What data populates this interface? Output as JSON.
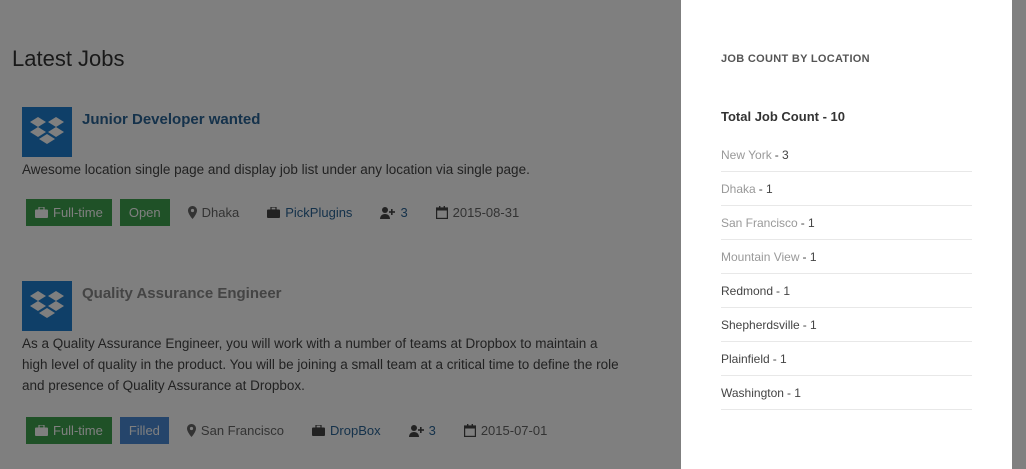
{
  "main": {
    "title": "Latest Jobs",
    "jobs": [
      {
        "title": "Junior Developer wanted",
        "description": "Awesome location single page and display job list under any location via single page.",
        "type": "Full-time",
        "status": "Open",
        "location": "Dhaka",
        "company": "PickPlugins",
        "applicants": "3",
        "date": "2015-08-31"
      },
      {
        "title": "Quality Assurance Engineer",
        "description": "As a Quality Assurance Engineer, you will work with a number of teams at Dropbox to maintain a high level of quality in the product. You will be joining a small team at a critical time to define the role and presence of Quality Assurance at Dropbox.",
        "type": "Full-time",
        "status": "Filled",
        "location": "San Francisco",
        "company": "DropBox",
        "applicants": "3",
        "date": "2015-07-01"
      }
    ]
  },
  "sidebar": {
    "widget_title": "JOB COUNT BY LOCATION",
    "total": "Total Job Count - 10",
    "locations": [
      {
        "name": "New York",
        "count": " - 3"
      },
      {
        "name": "Dhaka",
        "count": " - 1"
      },
      {
        "name": "San Francisco",
        "count": " - 1"
      },
      {
        "name": "Mountain View",
        "count": " - 1"
      },
      {
        "name": "Redmond",
        "count": " - 1"
      },
      {
        "name": "Shepherdsville",
        "count": " - 1"
      },
      {
        "name": "Plainfield",
        "count": " - 1"
      },
      {
        "name": "Washington",
        "count": " - 1"
      }
    ]
  },
  "colors": {
    "logo": "#1f7fd0",
    "badge_green": "#3ea24e",
    "badge_blue": "#4a8bd6",
    "link": "#2a6496",
    "overlay": "rgba(0,0,0,0.5)"
  },
  "icons": [
    "dropbox-logo-icon",
    "briefcase-icon",
    "map-marker-icon",
    "user-plus-icon",
    "calendar-icon"
  ]
}
